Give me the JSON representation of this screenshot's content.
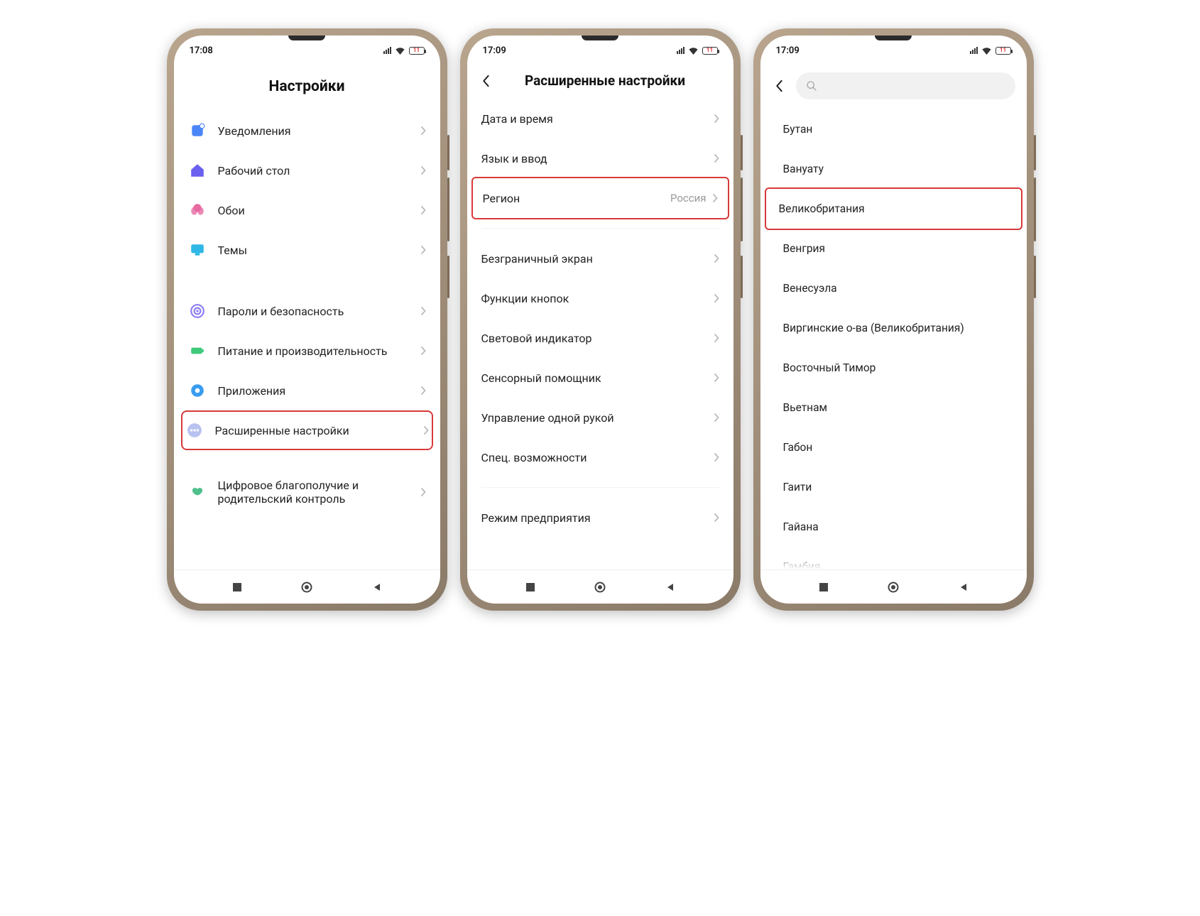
{
  "status": {
    "time1": "17:08",
    "time2": "17:09",
    "time3": "17:09",
    "battery": "11"
  },
  "screen1": {
    "title": "Настройки",
    "group1": [
      {
        "label": "Уведомления",
        "icon": "notif",
        "color": "#4a86f7"
      },
      {
        "label": "Рабочий стол",
        "icon": "home",
        "color": "#6b5ff0"
      },
      {
        "label": "Обои",
        "icon": "flower",
        "color": "#e76aa2"
      },
      {
        "label": "Темы",
        "icon": "theme",
        "color": "#2fb8e6"
      }
    ],
    "group2": [
      {
        "label": "Пароли и безопасность",
        "icon": "shield",
        "color": "#8c7ef2"
      },
      {
        "label": "Питание и производительность",
        "icon": "battery",
        "color": "#3fc97a"
      },
      {
        "label": "Приложения",
        "icon": "gear",
        "color": "#3a9cf0"
      },
      {
        "label": "Расширенные настройки",
        "icon": "dots",
        "color": "#b8c2f0",
        "highlight": true
      }
    ],
    "group3": [
      {
        "label": "Цифровое благополучие и родительский контроль",
        "icon": "heart",
        "color": "#4fc08d"
      }
    ]
  },
  "screen2": {
    "title": "Расширенные настройки",
    "group1": [
      {
        "label": "Дата и время"
      },
      {
        "label": "Язык и ввод"
      },
      {
        "label": "Регион",
        "value": "Россия",
        "highlight": true
      }
    ],
    "group2": [
      {
        "label": "Безграничный экран"
      },
      {
        "label": "Функции кнопок"
      },
      {
        "label": "Световой индикатор"
      },
      {
        "label": "Сенсорный помощник"
      },
      {
        "label": "Управление одной рукой"
      },
      {
        "label": "Спец. возможности"
      }
    ],
    "group3": [
      {
        "label": "Режим предприятия"
      }
    ]
  },
  "screen3": {
    "items": [
      "Бутан",
      "Вануату",
      "Великобритания",
      "Венгрия",
      "Венесуэла",
      "Виргинские о-ва (Великобритания)",
      "Восточный Тимор",
      "Вьетнам",
      "Габон",
      "Гаити",
      "Гайана",
      "Гамбия"
    ],
    "highlight_index": 2
  }
}
